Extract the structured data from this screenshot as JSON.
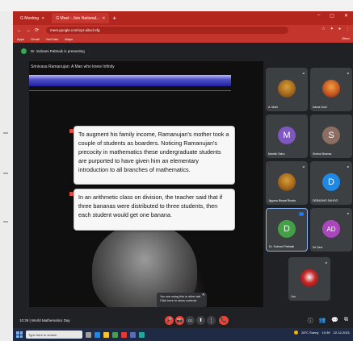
{
  "browser": {
    "tabs": [
      {
        "label": "G Meeting",
        "active": false
      },
      {
        "label": "G Meet - Join National...",
        "active": true
      }
    ],
    "new_tab": "+",
    "window_controls": [
      "–",
      "▢",
      "✕"
    ],
    "address": "meet.google.com/xyz-abcd-efg",
    "bookmarks": [
      "Apps",
      "Gmail",
      "YouTube",
      "Maps"
    ],
    "bookmarks_right": "Other"
  },
  "meet": {
    "presenting_label": "Dr. Subrani Pattnaik is presenting",
    "meeting_title": "10:39 | World Mathematics Day",
    "toast": {
      "text": "You are using this in other tab. Click here to show controls",
      "close": "✕"
    }
  },
  "slide": {
    "title": "Srinivasa Ramanujan: A Man who knew Infinity",
    "paragraph1": "To augment his family income, Ramanujan's mother took a couple of students as boarders. Noticing Ramanujan's precocity in mathematics these undergraduate students are purported to have given him an elementary introduction to all branches of mathematics.",
    "paragraph2": "In an arithmetic class on division, the teacher said that if three bananas were distributed to three students, then each student would get one banana."
  },
  "participants": [
    {
      "name": "A. Mani",
      "initial": "",
      "color": "#3c4043",
      "photo": true
    },
    {
      "name": "Aarna Goel",
      "initial": "",
      "color": "#3c4043",
      "photo": true
    },
    {
      "name": "Manish Sahu",
      "initial": "M",
      "color": "#7e57c2",
      "photo": false
    },
    {
      "name": "Sneha Sharma",
      "initial": "S",
      "color": "#8d6e63",
      "photo": false
    },
    {
      "name": "Jigyasa Biswal Bhatia",
      "initial": "",
      "color": "#3c4043",
      "photo": true
    },
    {
      "name": "DEBASHIS SAHOO",
      "initial": "D",
      "color": "#1e88e5",
      "photo": false
    },
    {
      "name": "Dr. Subrani Pattnaik",
      "initial": "D",
      "color": "#43a047",
      "photo": false
    },
    {
      "name": "Sri Devi",
      "initial": "AD",
      "color": "#ab47bc",
      "photo": false
    },
    {
      "name": "You",
      "initial": "",
      "color": "#3c4043",
      "photo": true
    }
  ],
  "controls": {
    "mic": "🎤",
    "camera": "📷",
    "captions": "CC",
    "present": "⬆",
    "more": "⋮",
    "end": "📞"
  },
  "right_icons": [
    "ⓘ",
    "👥",
    "💬",
    "⧉"
  ],
  "taskbar": {
    "search_placeholder": "Type here to search",
    "weather": "28°C Sunny",
    "time": "10:39",
    "date": "22-12-2021"
  }
}
